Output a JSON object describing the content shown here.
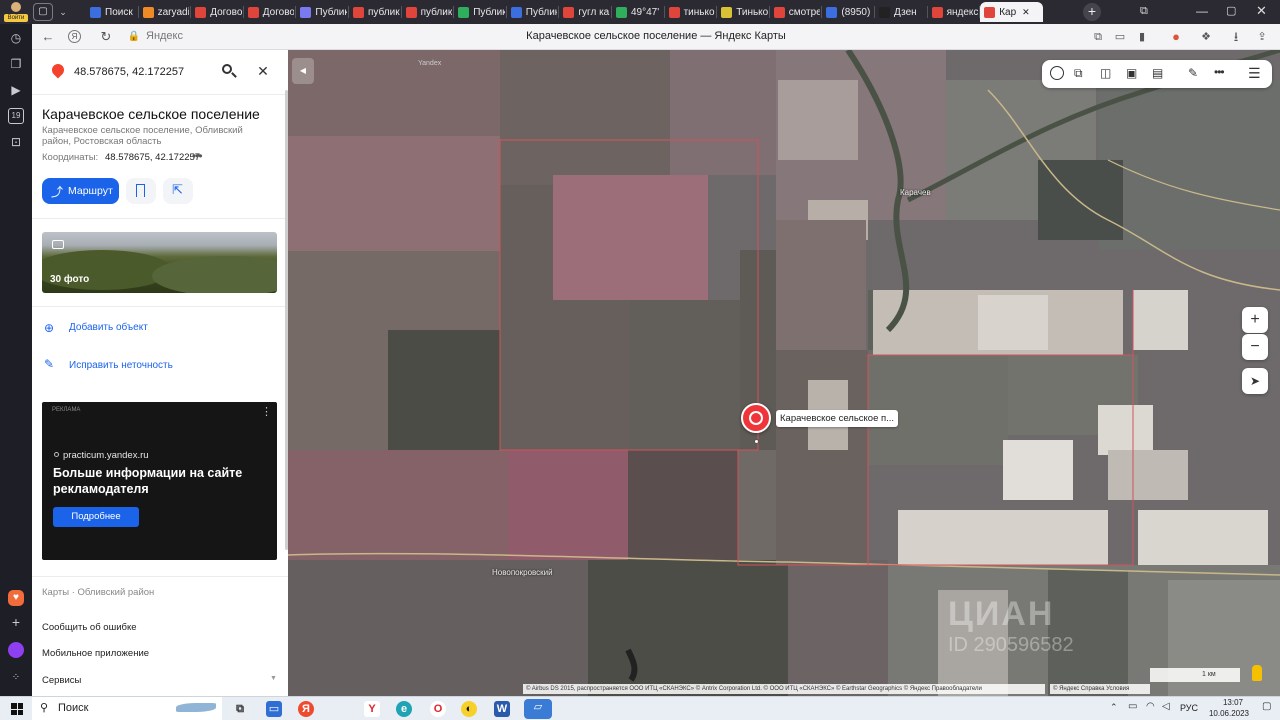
{
  "browser": {
    "profile_label": "Войти",
    "tabs": [
      {
        "label": "Поиск",
        "color": "#3b6fe0"
      },
      {
        "label": "zaryadi",
        "color": "#f08a24"
      },
      {
        "label": "Договор",
        "color": "#e0453c"
      },
      {
        "label": "Договор",
        "color": "#e0453c"
      },
      {
        "label": "Публик",
        "color": "#7a7af0"
      },
      {
        "label": "публик",
        "color": "#e0453c"
      },
      {
        "label": "публик",
        "color": "#e0453c"
      },
      {
        "label": "Публик",
        "color": "#2fae5b"
      },
      {
        "label": "Публик",
        "color": "#3b6fe0"
      },
      {
        "label": "гугл ка",
        "color": "#e0453c"
      },
      {
        "label": "49°47'",
        "color": "#2fae5b"
      },
      {
        "label": "тинько",
        "color": "#e0453c"
      },
      {
        "label": "Тинько",
        "color": "#d9c233"
      },
      {
        "label": "смотре",
        "color": "#e0453c"
      },
      {
        "label": "(8950)",
        "color": "#3b6fe0"
      },
      {
        "label": "Дзен",
        "color": "#222222"
      },
      {
        "label": "яндекс",
        "color": "#e0453c"
      },
      {
        "label": "Кар",
        "color": "#e0453c"
      }
    ],
    "address_host": "Яндекс",
    "page_title": "Карачевское сельское поселение — Яндекс Карты"
  },
  "search": {
    "value": "48.578675, 42.172257"
  },
  "place": {
    "title": "Карачевское сельское поселение",
    "subtitle": "Карачевское сельское поселение, Обливский район, Ростовская область",
    "coords_label": "Координаты:",
    "coords_value": "48.578675, 42.172257",
    "route_button": "Маршрут",
    "photo_count": "30 фото",
    "add_object": "Добавить объект",
    "fix_error": "Исправить неточность"
  },
  "ad": {
    "label": "РЕКЛАМА",
    "domain": "practicum.yandex.ru",
    "headline": "Больше информации на сайте рекламодателя",
    "button": "Подробнее"
  },
  "footer": {
    "breadcrumb_root": "Карты",
    "breadcrumb_sep": "·",
    "breadcrumb_leaf": "Обливский район",
    "links": [
      "Сообщить об ошибке",
      "Мобильное приложение",
      "Сервисы"
    ]
  },
  "map": {
    "marker_label": "Карачевское сельское п...",
    "place_labels": [
      "Карачев",
      "Новопокровский",
      "Yandex"
    ],
    "copyright": "© Airbus DS 2015, распространяется ООО ИТЦ «СКАНЭКС» © Antrix Corporation Ltd. © ООО ИТЦ «СКАНЭКС» © Earthstar Geographics © Яндекс  Правообладатели",
    "copyright_links": "© Яндекс  Справка  Условия",
    "scale_label": "1 км",
    "watermark": "ЦИАН",
    "watermark_id": "ID 290596582"
  },
  "taskbar": {
    "search_placeholder": "Поиск",
    "lang": "РУС",
    "time": "13:07",
    "date": "10.06.2023"
  }
}
